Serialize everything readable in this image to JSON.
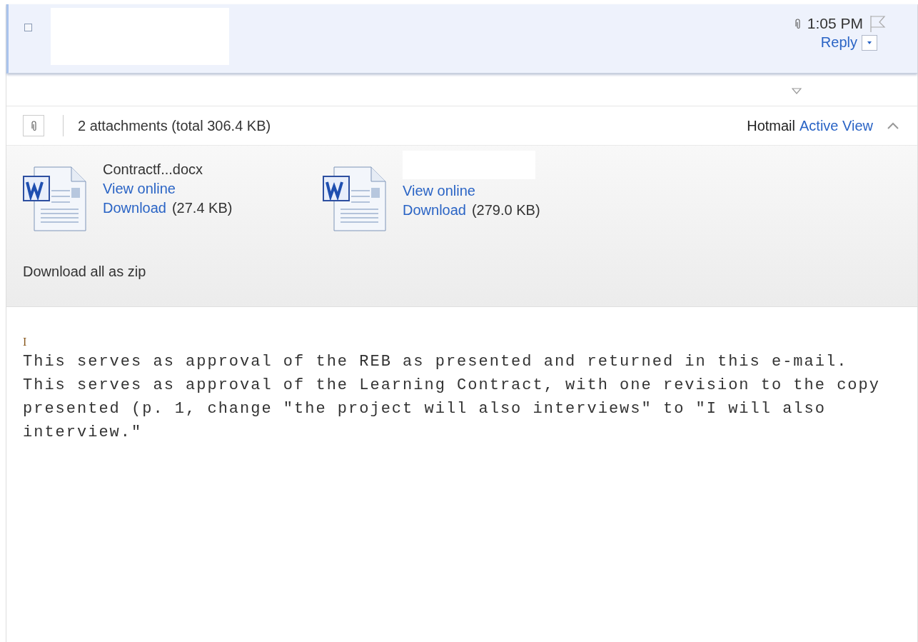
{
  "header": {
    "checked": false,
    "time": "1:05 PM",
    "reply": "Reply",
    "flagged": false
  },
  "attachments_bar": {
    "summary": "2 attachments (total 306.4 KB)",
    "brand": "Hotmail",
    "link": "Active View"
  },
  "attachments": [
    {
      "name": "Contractf...docx",
      "view": "View online",
      "download": "Download",
      "size": "(27.4 KB)"
    },
    {
      "view": "View online",
      "download": "Download",
      "size": "(279.0 KB)"
    }
  ],
  "download_all": "Download all as zip",
  "body": {
    "mark": "I",
    "lines": [
      "This serves as approval of the REB as presented and returned in this e-mail.",
      "This serves as approval of the Learning Contract, with one revision to the copy",
      "presented (p. 1, change \"the project will also interviews\" to \"I will also",
      "interview.\""
    ]
  }
}
